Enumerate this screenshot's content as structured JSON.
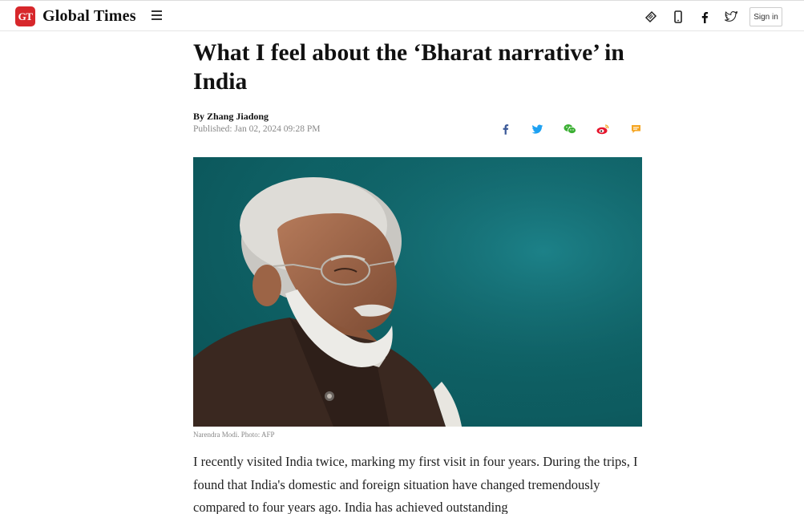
{
  "header": {
    "logo_badge": "GT",
    "logo_text": "Global Times",
    "menu_icon": "hamburger-icon",
    "icons": [
      "epaper-icon",
      "mobile-icon",
      "facebook-icon",
      "twitter-icon"
    ],
    "signin_label": "Sign in"
  },
  "article": {
    "headline": "What I feel about the ‘Bharat narrative’ in India",
    "byline": "By Zhang Jiadong",
    "published": "Published: Jan 02, 2024 09:28 PM",
    "share_icons": [
      "facebook-icon",
      "twitter-icon",
      "wechat-icon",
      "weibo-icon",
      "comment-icon"
    ],
    "photo_caption": "Narendra Modi. Photo: AFP",
    "body": "I recently visited India twice, marking my first visit in four years. During the trips, I found that India's domestic and foreign situation have changed tremendously compared to four years ago. India has achieved outstanding"
  },
  "colors": {
    "brand_red": "#d7272b",
    "facebook": "#3b5998",
    "twitter": "#1da1f2",
    "wechat": "#3cb034",
    "weibo": "#e6162d",
    "comment": "#f5a623",
    "photo_bg": "#0f6468"
  }
}
